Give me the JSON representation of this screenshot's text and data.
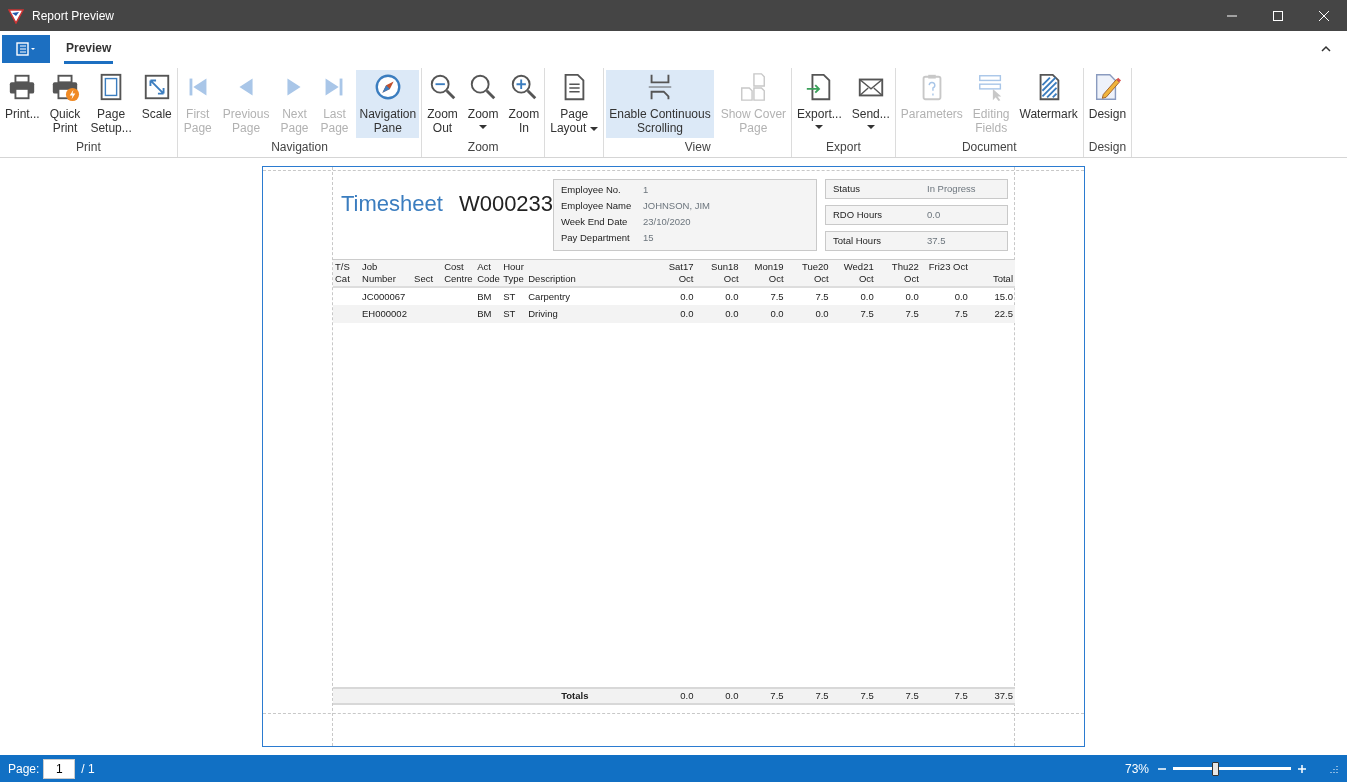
{
  "window": {
    "title": "Report Preview"
  },
  "tabs": [
    {
      "label": "Preview",
      "selected": true
    }
  ],
  "ribbon": {
    "groups": [
      {
        "label": "Print",
        "buttons": [
          {
            "label": "Print...",
            "kind": "printer",
            "selected": false,
            "disabled": false
          },
          {
            "label": "Quick\nPrint",
            "kind": "quick-print",
            "selected": false,
            "disabled": false
          },
          {
            "label": "Page\nSetup...",
            "kind": "page-setup",
            "selected": false,
            "disabled": false
          },
          {
            "label": "Scale",
            "kind": "scale",
            "selected": false,
            "disabled": false
          }
        ]
      },
      {
        "label": "Navigation",
        "buttons": [
          {
            "label": "First\nPage",
            "kind": "first",
            "selected": false,
            "disabled": true
          },
          {
            "label": "Previous\nPage",
            "kind": "previous",
            "selected": false,
            "disabled": true
          },
          {
            "label": "Next\nPage",
            "kind": "next",
            "selected": false,
            "disabled": true
          },
          {
            "label": "Last\nPage",
            "kind": "last",
            "selected": false,
            "disabled": true
          },
          {
            "label": "Navigation\nPane",
            "kind": "compass",
            "selected": true,
            "disabled": false
          }
        ]
      },
      {
        "label": "Zoom",
        "buttons": [
          {
            "label": "Zoom\nOut",
            "kind": "zoom-out",
            "selected": false,
            "disabled": false
          },
          {
            "label": "Zoom",
            "kind": "zoom",
            "dropdown": true,
            "selected": false,
            "disabled": false
          },
          {
            "label": "Zoom\nIn",
            "kind": "zoom-in",
            "selected": false,
            "disabled": false
          }
        ]
      },
      {
        "buttons": [
          {
            "label": "Page\nLayout",
            "kind": "page-layout",
            "dropdown": true,
            "selected": false,
            "disabled": false
          }
        ]
      },
      {
        "label": "View",
        "buttons": [
          {
            "label": "Enable Continuous\nScrolling",
            "kind": "continuous",
            "selected": true,
            "disabled": false
          },
          {
            "label": "Show Cover\nPage",
            "kind": "cover",
            "selected": false,
            "disabled": true
          }
        ]
      },
      {
        "label": "Export",
        "buttons": [
          {
            "label": "Export...",
            "kind": "export",
            "dropdown": true,
            "selected": false,
            "disabled": false
          },
          {
            "label": "Send...",
            "kind": "send",
            "dropdown": true,
            "selected": false,
            "disabled": false
          }
        ]
      },
      {
        "label": "Document",
        "buttons": [
          {
            "label": "Parameters",
            "kind": "parameters",
            "selected": false,
            "disabled": true
          },
          {
            "label": "Editing\nFields",
            "kind": "editing-fields",
            "selected": false,
            "disabled": true
          },
          {
            "label": "Watermark",
            "kind": "watermark",
            "selected": false,
            "disabled": false
          }
        ]
      },
      {
        "label": "Design",
        "buttons": [
          {
            "label": "Design",
            "kind": "design",
            "selected": false,
            "disabled": false
          }
        ]
      }
    ]
  },
  "report": {
    "title": "Timesheet",
    "number": "W000233",
    "employee": [
      {
        "label": "Employee No.",
        "value": "1"
      },
      {
        "label": "Employee Name",
        "value": "JOHNSON, JIM"
      },
      {
        "label": "Week End Date",
        "value": "23/10/2020"
      },
      {
        "label": "Pay Department",
        "value": "15"
      }
    ],
    "summary": [
      {
        "label": "Status",
        "value": "In Progress"
      },
      {
        "label": "RDO Hours",
        "value": "0.0"
      },
      {
        "label": "Total Hours",
        "value": "37.5"
      }
    ],
    "table": {
      "columns": [
        "T/S\nCat",
        "Job\nNumber",
        "Sect",
        "Cost\nCentre",
        "Act\nCode",
        "Hour\nType",
        "Description",
        "Sat17\nOct",
        "Sun18\nOct",
        "Mon19\nOct",
        "Tue20\nOct",
        "Wed21\nOct",
        "Thu22\nOct",
        "Fri23 Oct",
        "Total"
      ],
      "rows": [
        [
          "",
          "JC000067",
          "",
          "",
          "BM",
          "ST",
          "Carpentry",
          "0.0",
          "0.0",
          "7.5",
          "7.5",
          "0.0",
          "0.0",
          "0.0",
          "15.0"
        ],
        [
          "",
          "EH000002",
          "",
          "",
          "BM",
          "ST",
          "Driving",
          "0.0",
          "0.0",
          "0.0",
          "0.0",
          "7.5",
          "7.5",
          "7.5",
          "22.5"
        ]
      ],
      "totals": {
        "label": "Totals",
        "values": [
          "0.0",
          "0.0",
          "7.5",
          "7.5",
          "7.5",
          "7.5",
          "7.5",
          "37.5"
        ]
      }
    }
  },
  "status_bar": {
    "page_label": "Page:",
    "page_value": "1",
    "page_count": "/ 1",
    "zoom_reading": "73%",
    "zoom": {
      "level": 0.36
    }
  }
}
